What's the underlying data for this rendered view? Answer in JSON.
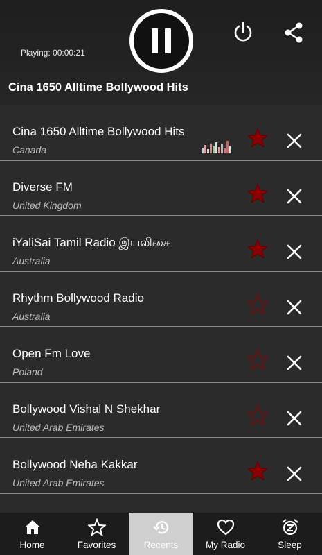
{
  "header": {
    "playing_text": "Playing: 00:00:21",
    "now_playing_title": "Cina 1650 Alltime Bollywood Hits"
  },
  "stations": [
    {
      "name": "Cina 1650 Alltime Bollywood Hits",
      "country": "Canada",
      "favorite": true,
      "playing": true
    },
    {
      "name": "Diverse FM",
      "country": "United Kingdom",
      "favorite": true,
      "playing": false
    },
    {
      "name": "iYaliSai Tamil Radio இயலிசை",
      "country": "Australia",
      "favorite": true,
      "playing": false
    },
    {
      "name": "Rhythm Bollywood Radio",
      "country": "Australia",
      "favorite": false,
      "playing": false
    },
    {
      "name": "Open Fm Love",
      "country": "Poland",
      "favorite": false,
      "playing": false
    },
    {
      "name": "Bollywood Vishal N Shekhar",
      "country": "United Arab Emirates",
      "favorite": false,
      "playing": false
    },
    {
      "name": "Bollywood Neha Kakkar",
      "country": "United Arab Emirates",
      "favorite": true,
      "playing": false
    }
  ],
  "nav": [
    {
      "label": "Home",
      "icon": "home-icon",
      "active": false
    },
    {
      "label": "Favorites",
      "icon": "star-outline-icon",
      "active": false
    },
    {
      "label": "Recents",
      "icon": "history-icon",
      "active": true
    },
    {
      "label": "My Radio",
      "icon": "heart-outline-icon",
      "active": false
    },
    {
      "label": "Sleep",
      "icon": "alarm-snooze-icon",
      "active": false
    }
  ],
  "colors": {
    "star_filled": "#8b0000",
    "star_outline": "#5a1515",
    "header_bg": "#1e1e1e",
    "list_bg": "#2b2b2b",
    "active_nav_bg": "#cfcfcf"
  }
}
